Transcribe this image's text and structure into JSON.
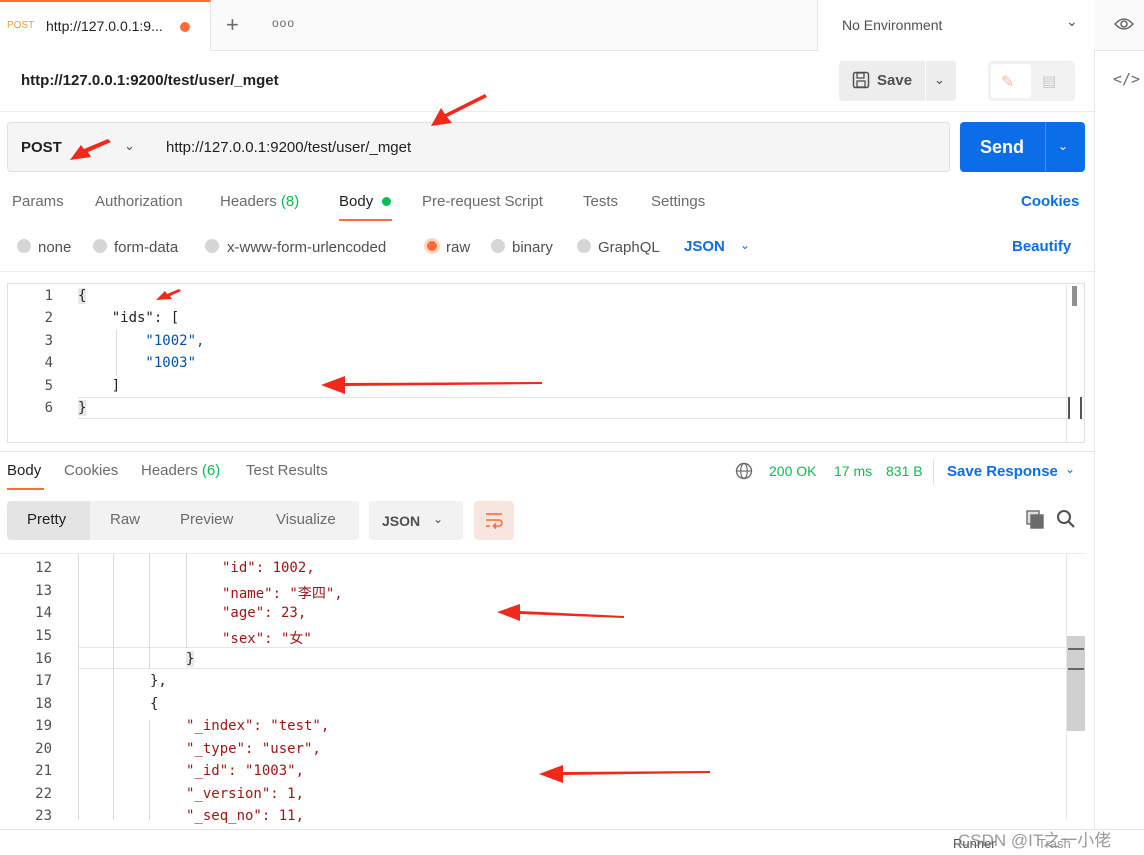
{
  "tab": {
    "method": "POST",
    "title": "http://127.0.0.1:9..."
  },
  "environment": {
    "label": "No Environment"
  },
  "request": {
    "name": "http://127.0.0.1:9200/test/user/_mget",
    "save_label": "Save",
    "method": "POST",
    "url": "http://127.0.0.1:9200/test/user/_mget",
    "send_label": "Send"
  },
  "request_tabs": {
    "params": "Params",
    "authorization": "Authorization",
    "headers": "Headers",
    "headers_count": "(8)",
    "body": "Body",
    "prerequest": "Pre-request Script",
    "tests": "Tests",
    "settings": "Settings",
    "cookies": "Cookies"
  },
  "body_types": {
    "none": "none",
    "form_data": "form-data",
    "urlencoded": "x-www-form-urlencoded",
    "raw": "raw",
    "binary": "binary",
    "graphql": "GraphQL",
    "selected": "raw",
    "format": "JSON",
    "beautify": "Beautify"
  },
  "request_body": {
    "line_numbers": [
      "1",
      "2",
      "3",
      "4",
      "5",
      "6"
    ],
    "lines": [
      "{",
      "    \"ids\": [",
      "        \"1002\",",
      "        \"1003\"",
      "    ]",
      "}"
    ]
  },
  "response_tabs": {
    "body": "Body",
    "cookies": "Cookies",
    "headers": "Headers",
    "headers_count": "(6)",
    "test_results": "Test Results"
  },
  "response_status": {
    "code": "200 OK",
    "time": "17 ms",
    "size": "831 B",
    "save_response": "Save Response"
  },
  "view_modes": {
    "pretty": "Pretty",
    "raw": "Raw",
    "preview": "Preview",
    "visualize": "Visualize",
    "format": "JSON"
  },
  "response_body": {
    "line_numbers": [
      "12",
      "13",
      "14",
      "15",
      "16",
      "17",
      "18",
      "19",
      "20",
      "21",
      "22",
      "23"
    ],
    "lines": [
      "\"id\": 1002,",
      "\"name\": \"李四\",",
      "\"age\": 23,",
      "\"sex\": \"女\"",
      "}",
      "},",
      "{",
      "\"_index\": \"test\",",
      "\"_type\": \"user\",",
      "\"_id\": \"1003\",",
      "\"_version\": 1,",
      "\"_seq_no\": 11,"
    ]
  },
  "footer": {
    "runner": "Runner",
    "trash": "Trash",
    "watermark": "CSDN @IT之一小佬"
  },
  "colors": {
    "accent": "#ff6c37",
    "primary": "#0b6ee8",
    "success": "#0cbb52",
    "annotation_arrow": "#f0291b"
  },
  "icons": [
    "eye-icon",
    "code-icon",
    "save-icon",
    "pencil-icon",
    "comment-icon",
    "chevron-down-icon",
    "globe-icon",
    "wrap-icon",
    "copy-icon",
    "search-icon",
    "plus-icon",
    "more-icon"
  ]
}
